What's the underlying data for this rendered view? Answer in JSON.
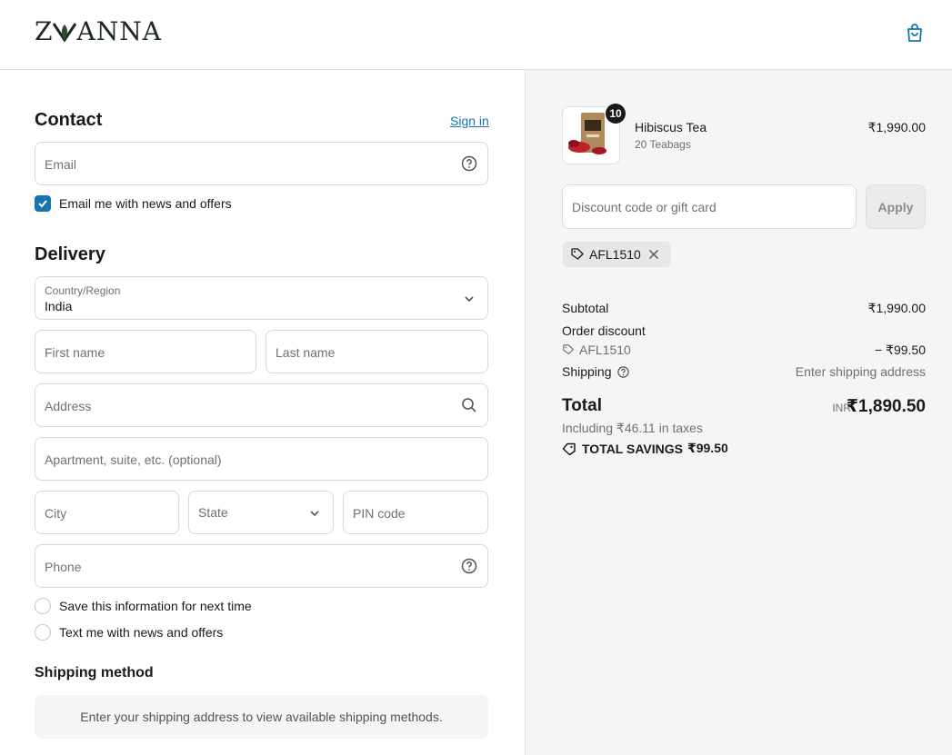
{
  "brand": {
    "logo_text_left": "Z",
    "logo_text_right": "ANNA"
  },
  "contact": {
    "heading": "Contact",
    "signin_label": "Sign in",
    "email_placeholder": "Email",
    "news_label": "Email me with news and offers",
    "news_checked": true
  },
  "delivery": {
    "heading": "Delivery",
    "country_label": "Country/Region",
    "country_value": "India",
    "first_name_placeholder": "First name",
    "last_name_placeholder": "Last name",
    "address_placeholder": "Address",
    "apartment_placeholder": "Apartment, suite, etc. (optional)",
    "city_placeholder": "City",
    "state_placeholder": "State",
    "pin_placeholder": "PIN code",
    "phone_placeholder": "Phone",
    "save_info_label": "Save this information for next time",
    "text_offers_label": "Text me with news and offers"
  },
  "shipping": {
    "heading": "Shipping method",
    "message": "Enter your shipping address to view available shipping methods."
  },
  "cart": {
    "item": {
      "name": "Hibiscus Tea",
      "variant": "20 Teabags",
      "price": "₹1,990.00",
      "quantity": "10"
    },
    "discount_placeholder": "Discount code or gift card",
    "apply_label": "Apply",
    "applied_code": "AFL1510"
  },
  "summary": {
    "subtotal_label": "Subtotal",
    "subtotal_value": "₹1,990.00",
    "order_discount_label": "Order discount",
    "discount_code": "AFL1510",
    "discount_value": "− ₹99.50",
    "shipping_label": "Shipping",
    "shipping_value": "Enter shipping address",
    "total_label": "Total",
    "total_currency": "INR",
    "total_value": "₹1,890.50",
    "taxes_text": "Including ₹46.11 in taxes",
    "savings_label": "TOTAL SAVINGS",
    "savings_value": "₹99.50"
  },
  "colors": {
    "accent": "#1773b0",
    "sidebar_bg": "#f5f5f5",
    "border": "#d9d9d9"
  }
}
